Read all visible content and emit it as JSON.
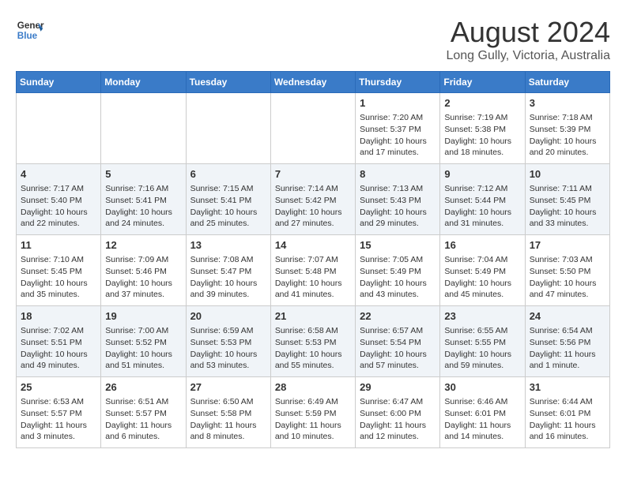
{
  "header": {
    "logo_line1": "General",
    "logo_line2": "Blue",
    "month": "August 2024",
    "location": "Long Gully, Victoria, Australia"
  },
  "weekdays": [
    "Sunday",
    "Monday",
    "Tuesday",
    "Wednesday",
    "Thursday",
    "Friday",
    "Saturday"
  ],
  "weeks": [
    [
      {
        "day": "",
        "info": ""
      },
      {
        "day": "",
        "info": ""
      },
      {
        "day": "",
        "info": ""
      },
      {
        "day": "",
        "info": ""
      },
      {
        "day": "1",
        "info": "Sunrise: 7:20 AM\nSunset: 5:37 PM\nDaylight: 10 hours\nand 17 minutes."
      },
      {
        "day": "2",
        "info": "Sunrise: 7:19 AM\nSunset: 5:38 PM\nDaylight: 10 hours\nand 18 minutes."
      },
      {
        "day": "3",
        "info": "Sunrise: 7:18 AM\nSunset: 5:39 PM\nDaylight: 10 hours\nand 20 minutes."
      }
    ],
    [
      {
        "day": "4",
        "info": "Sunrise: 7:17 AM\nSunset: 5:40 PM\nDaylight: 10 hours\nand 22 minutes."
      },
      {
        "day": "5",
        "info": "Sunrise: 7:16 AM\nSunset: 5:41 PM\nDaylight: 10 hours\nand 24 minutes."
      },
      {
        "day": "6",
        "info": "Sunrise: 7:15 AM\nSunset: 5:41 PM\nDaylight: 10 hours\nand 25 minutes."
      },
      {
        "day": "7",
        "info": "Sunrise: 7:14 AM\nSunset: 5:42 PM\nDaylight: 10 hours\nand 27 minutes."
      },
      {
        "day": "8",
        "info": "Sunrise: 7:13 AM\nSunset: 5:43 PM\nDaylight: 10 hours\nand 29 minutes."
      },
      {
        "day": "9",
        "info": "Sunrise: 7:12 AM\nSunset: 5:44 PM\nDaylight: 10 hours\nand 31 minutes."
      },
      {
        "day": "10",
        "info": "Sunrise: 7:11 AM\nSunset: 5:45 PM\nDaylight: 10 hours\nand 33 minutes."
      }
    ],
    [
      {
        "day": "11",
        "info": "Sunrise: 7:10 AM\nSunset: 5:45 PM\nDaylight: 10 hours\nand 35 minutes."
      },
      {
        "day": "12",
        "info": "Sunrise: 7:09 AM\nSunset: 5:46 PM\nDaylight: 10 hours\nand 37 minutes."
      },
      {
        "day": "13",
        "info": "Sunrise: 7:08 AM\nSunset: 5:47 PM\nDaylight: 10 hours\nand 39 minutes."
      },
      {
        "day": "14",
        "info": "Sunrise: 7:07 AM\nSunset: 5:48 PM\nDaylight: 10 hours\nand 41 minutes."
      },
      {
        "day": "15",
        "info": "Sunrise: 7:05 AM\nSunset: 5:49 PM\nDaylight: 10 hours\nand 43 minutes."
      },
      {
        "day": "16",
        "info": "Sunrise: 7:04 AM\nSunset: 5:49 PM\nDaylight: 10 hours\nand 45 minutes."
      },
      {
        "day": "17",
        "info": "Sunrise: 7:03 AM\nSunset: 5:50 PM\nDaylight: 10 hours\nand 47 minutes."
      }
    ],
    [
      {
        "day": "18",
        "info": "Sunrise: 7:02 AM\nSunset: 5:51 PM\nDaylight: 10 hours\nand 49 minutes."
      },
      {
        "day": "19",
        "info": "Sunrise: 7:00 AM\nSunset: 5:52 PM\nDaylight: 10 hours\nand 51 minutes."
      },
      {
        "day": "20",
        "info": "Sunrise: 6:59 AM\nSunset: 5:53 PM\nDaylight: 10 hours\nand 53 minutes."
      },
      {
        "day": "21",
        "info": "Sunrise: 6:58 AM\nSunset: 5:53 PM\nDaylight: 10 hours\nand 55 minutes."
      },
      {
        "day": "22",
        "info": "Sunrise: 6:57 AM\nSunset: 5:54 PM\nDaylight: 10 hours\nand 57 minutes."
      },
      {
        "day": "23",
        "info": "Sunrise: 6:55 AM\nSunset: 5:55 PM\nDaylight: 10 hours\nand 59 minutes."
      },
      {
        "day": "24",
        "info": "Sunrise: 6:54 AM\nSunset: 5:56 PM\nDaylight: 11 hours\nand 1 minute."
      }
    ],
    [
      {
        "day": "25",
        "info": "Sunrise: 6:53 AM\nSunset: 5:57 PM\nDaylight: 11 hours\nand 3 minutes."
      },
      {
        "day": "26",
        "info": "Sunrise: 6:51 AM\nSunset: 5:57 PM\nDaylight: 11 hours\nand 6 minutes."
      },
      {
        "day": "27",
        "info": "Sunrise: 6:50 AM\nSunset: 5:58 PM\nDaylight: 11 hours\nand 8 minutes."
      },
      {
        "day": "28",
        "info": "Sunrise: 6:49 AM\nSunset: 5:59 PM\nDaylight: 11 hours\nand 10 minutes."
      },
      {
        "day": "29",
        "info": "Sunrise: 6:47 AM\nSunset: 6:00 PM\nDaylight: 11 hours\nand 12 minutes."
      },
      {
        "day": "30",
        "info": "Sunrise: 6:46 AM\nSunset: 6:01 PM\nDaylight: 11 hours\nand 14 minutes."
      },
      {
        "day": "31",
        "info": "Sunrise: 6:44 AM\nSunset: 6:01 PM\nDaylight: 11 hours\nand 16 minutes."
      }
    ]
  ]
}
